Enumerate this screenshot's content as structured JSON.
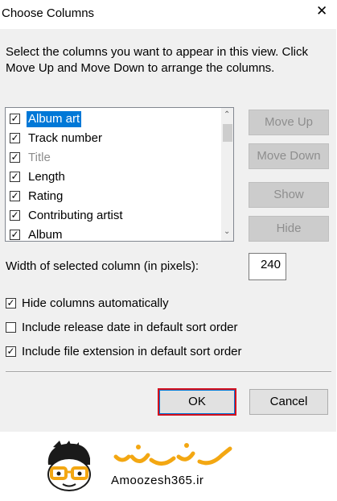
{
  "dialog": {
    "title": "Choose Columns",
    "close_glyph": "✕",
    "instructions": "Select the columns you want to appear in this view. Click Move Up and Move Down to arrange the columns."
  },
  "columns": [
    {
      "label": "Album art",
      "checked": true,
      "selected": true,
      "disabled": false
    },
    {
      "label": "Track number",
      "checked": true,
      "selected": false,
      "disabled": false
    },
    {
      "label": "Title",
      "checked": true,
      "selected": false,
      "disabled": true
    },
    {
      "label": "Length",
      "checked": true,
      "selected": false,
      "disabled": false
    },
    {
      "label": "Rating",
      "checked": true,
      "selected": false,
      "disabled": false
    },
    {
      "label": "Contributing artist",
      "checked": true,
      "selected": false,
      "disabled": false
    },
    {
      "label": "Album",
      "checked": true,
      "selected": false,
      "disabled": false
    }
  ],
  "buttons": {
    "move_up": "Move Up",
    "move_down": "Move Down",
    "show": "Show",
    "hide": "Hide",
    "ok": "OK",
    "cancel": "Cancel"
  },
  "width": {
    "label": "Width of selected column (in pixels):",
    "value": "240"
  },
  "options": [
    {
      "label": "Hide columns automatically",
      "checked": true
    },
    {
      "label": "Include release date in default sort order",
      "checked": false
    },
    {
      "label": "Include file extension in default sort order",
      "checked": true
    }
  ],
  "check_glyph": "✓",
  "scroll": {
    "up_glyph": "⌃",
    "down_glyph": "⌄"
  },
  "watermark": {
    "text": "Amoozesh365.ir",
    "brand_color": "#f3a712",
    "ink_color": "#1a1a1a"
  }
}
